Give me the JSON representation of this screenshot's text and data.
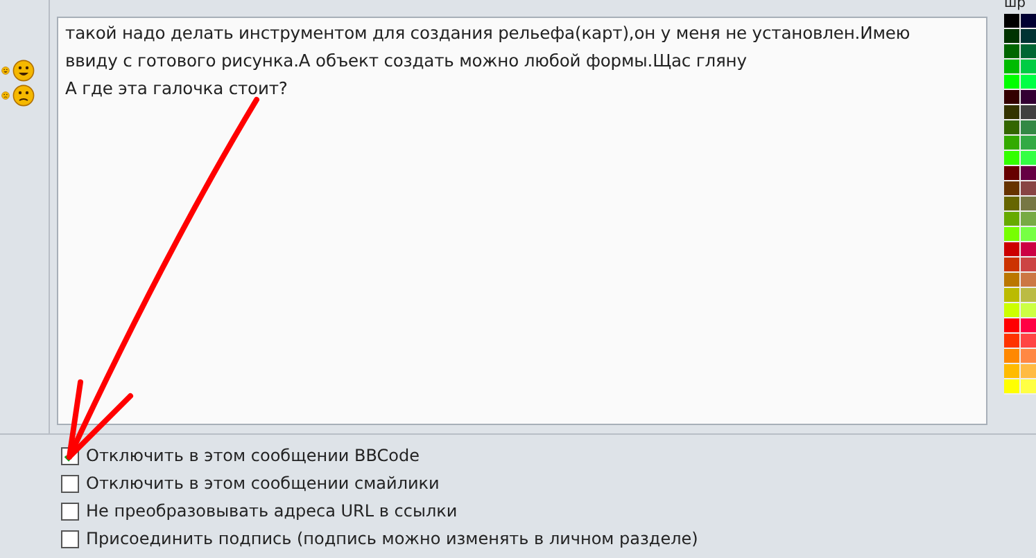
{
  "palette": {
    "label": "шр",
    "rows": [
      {
        "cells": [
          {
            "color": "#000000"
          },
          {
            "color": "#000033"
          }
        ]
      },
      {
        "cells": [
          {
            "color": "#003300"
          },
          {
            "color": "#003333"
          }
        ]
      },
      {
        "cells": [
          {
            "color": "#006600"
          },
          {
            "color": "#006633"
          }
        ]
      },
      {
        "cells": [
          {
            "color": "#00bb00"
          },
          {
            "color": "#00cc44"
          }
        ]
      },
      {
        "cells": [
          {
            "color": "#00ff00"
          },
          {
            "color": "#00ff44"
          }
        ]
      },
      {
        "cells": [
          {
            "color": "#330000"
          },
          {
            "color": "#330033"
          }
        ]
      },
      {
        "cells": [
          {
            "color": "#333300"
          },
          {
            "color": "#404040"
          }
        ]
      },
      {
        "cells": [
          {
            "color": "#336600"
          },
          {
            "color": "#338844"
          }
        ]
      },
      {
        "cells": [
          {
            "color": "#33aa00"
          },
          {
            "color": "#33aa44"
          }
        ]
      },
      {
        "cells": [
          {
            "color": "#33ff00"
          },
          {
            "color": "#33ff44"
          }
        ]
      },
      {
        "cells": [
          {
            "color": "#660000"
          },
          {
            "color": "#660044"
          }
        ]
      },
      {
        "cells": [
          {
            "color": "#663300"
          },
          {
            "color": "#884444"
          }
        ]
      },
      {
        "cells": [
          {
            "color": "#666600"
          },
          {
            "color": "#777744"
          }
        ]
      },
      {
        "cells": [
          {
            "color": "#66aa00"
          },
          {
            "color": "#77aa44"
          }
        ]
      },
      {
        "cells": [
          {
            "color": "#77ff00"
          },
          {
            "color": "#77ff44"
          }
        ]
      },
      {
        "cells": [
          {
            "color": "#cc0000"
          },
          {
            "color": "#cc0044"
          }
        ]
      },
      {
        "cells": [
          {
            "color": "#cc3300"
          },
          {
            "color": "#cc4444"
          }
        ]
      },
      {
        "cells": [
          {
            "color": "#bb7700"
          },
          {
            "color": "#cc7744"
          }
        ]
      },
      {
        "cells": [
          {
            "color": "#bbbb00"
          },
          {
            "color": "#bbbb44"
          }
        ]
      },
      {
        "cells": [
          {
            "color": "#ccff00"
          },
          {
            "color": "#ccff44"
          }
        ]
      },
      {
        "cells": [
          {
            "color": "#ff0000"
          },
          {
            "color": "#ff0044"
          }
        ]
      },
      {
        "cells": [
          {
            "color": "#ff3300"
          },
          {
            "color": "#ff4444"
          }
        ]
      },
      {
        "cells": [
          {
            "color": "#ff8800"
          },
          {
            "color": "#ff8844"
          }
        ]
      },
      {
        "cells": [
          {
            "color": "#ffbb00"
          },
          {
            "color": "#ffbb44"
          }
        ]
      },
      {
        "cells": [
          {
            "color": "#ffff00"
          },
          {
            "color": "#ffff44"
          }
        ]
      }
    ]
  },
  "message": {
    "lines": [
      "такой надо делать инструментом для создания рельефа(карт),он у меня не установлен.Имею",
      "ввиду с готового рисунка.А объект создать можно любой формы.Щас гляну",
      "А где эта галочка стоит?"
    ]
  },
  "options": [
    {
      "label": "Отключить в этом сообщении BBCode",
      "checked": true
    },
    {
      "label": "Отключить в этом сообщении смайлики",
      "checked": false
    },
    {
      "label": "Не преобразовывать адреса URL в ссылки",
      "checked": false
    },
    {
      "label": "Присоединить подпись (подпись можно изменять в личном разделе)",
      "checked": false
    }
  ]
}
